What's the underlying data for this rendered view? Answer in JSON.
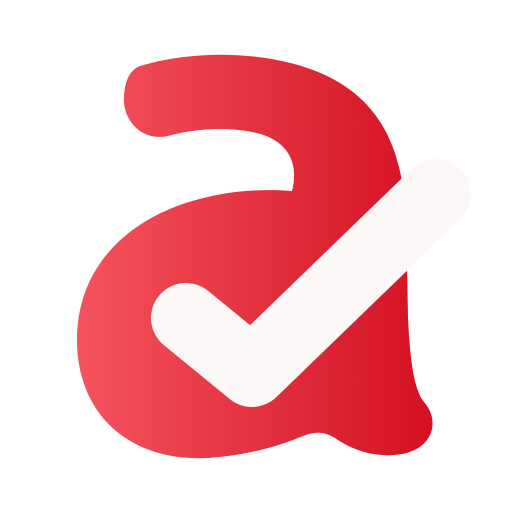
{
  "logo": {
    "icon": "red-lowercase-a-with-checkmark-logo",
    "colors": {
      "gradient_start": "#f4545e",
      "gradient_end": "#d20f20",
      "checkmark": "#fcf8f8",
      "background": "#ffffff"
    }
  }
}
